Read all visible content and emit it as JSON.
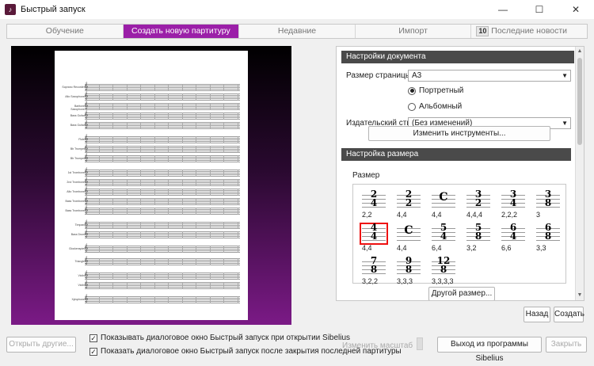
{
  "window": {
    "title": "Быстрый запуск",
    "minimize": "—",
    "maximize": "☐",
    "close": "✕"
  },
  "tabs": [
    {
      "label": "Обучение"
    },
    {
      "label": "Создать новую партитуру"
    },
    {
      "label": "Недавние"
    },
    {
      "label": "Импорт"
    },
    {
      "label": "Последние новости",
      "badge": "10"
    }
  ],
  "preview": {
    "instruments": [
      "Soprano Recorder",
      "Alto Saxophone",
      "Baritone Saxophone",
      "Bass Guitar",
      "Bass Guitar",
      "Flute",
      "Bb Trumpet",
      "Bb Trumpet",
      "1st Trombone",
      "2nd Trombone",
      "Alto Trombone",
      "Bass Trombone",
      "Bass Trombone",
      "Timpani",
      "Bass Drum",
      "Glockenspiel",
      "Triangle",
      "Violin",
      "Violin",
      "Xylophone"
    ]
  },
  "doc_settings": {
    "header": "Настройки документа",
    "page_size_label": "Размер страницы",
    "page_size_value": "A3",
    "portrait_label": "Портретный",
    "landscape_label": "Альбомный",
    "house_style_label": "Издательский стиль",
    "house_style_value": "(Без изменений)",
    "change_instruments": "Изменить инструменты..."
  },
  "size_settings": {
    "header": "Настройка размера",
    "size_label": "Размер",
    "signatures": [
      {
        "top": "2",
        "bottom": "4",
        "caption": "2,2"
      },
      {
        "top": "2",
        "bottom": "2",
        "caption": "4,4"
      },
      {
        "top": "C",
        "bottom": "",
        "caption": "4,4"
      },
      {
        "top": "3",
        "bottom": "2",
        "caption": "4,4,4"
      },
      {
        "top": "3",
        "bottom": "4",
        "caption": "2,2,2"
      },
      {
        "top": "3",
        "bottom": "8",
        "caption": "3"
      },
      {
        "top": "4",
        "bottom": "4",
        "caption": "4,4",
        "selected": true
      },
      {
        "top": "C",
        "bottom": "",
        "caption": "4,4"
      },
      {
        "top": "5",
        "bottom": "4",
        "caption": "6,4"
      },
      {
        "top": "5",
        "bottom": "8",
        "caption": "3,2"
      },
      {
        "top": "6",
        "bottom": "4",
        "caption": "6,6"
      },
      {
        "top": "6",
        "bottom": "8",
        "caption": "3,3"
      },
      {
        "top": "7",
        "bottom": "8",
        "caption": "3,2,2"
      },
      {
        "top": "9",
        "bottom": "8",
        "caption": "3,3,3"
      },
      {
        "top": "12",
        "bottom": "8",
        "caption": "3,3,3,3"
      }
    ],
    "other_size": "Другой размер..."
  },
  "nav": {
    "back": "Назад",
    "create": "Создать"
  },
  "footer": {
    "open_other": "Открыть другие...",
    "chk1": "Показывать диалоговое окно Быстрый запуск при открытии Sibelius",
    "chk2": "Показать диалоговое окно Быстрый запуск после закрытия последней партитуры",
    "zoom": "Изменить масштаб",
    "exit": "Выход из программы Sibelius",
    "close": "Закрыть",
    "check": "✓"
  }
}
